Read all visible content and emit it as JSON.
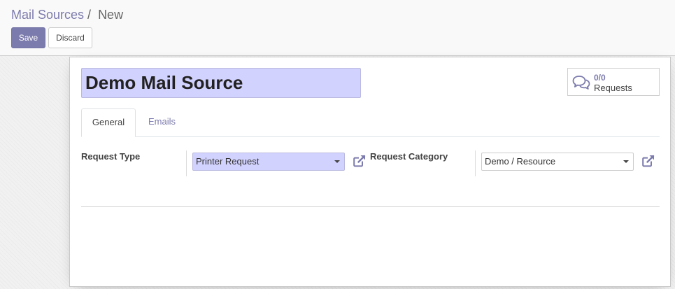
{
  "breadcrumb": {
    "parent": "Mail Sources",
    "separator": "/",
    "current": "New"
  },
  "buttons": {
    "save": "Save",
    "discard": "Discard"
  },
  "record": {
    "name": "Demo Mail Source"
  },
  "smart_button": {
    "value": "0/0",
    "label": "Requests",
    "icon": "comments-icon"
  },
  "tabs": [
    {
      "label": "General",
      "active": true
    },
    {
      "label": "Emails",
      "active": false
    }
  ],
  "fields": {
    "request_type": {
      "label": "Request Type",
      "value": "Printer Request"
    },
    "request_category": {
      "label": "Request Category",
      "value": "Demo / Resource"
    }
  },
  "colors": {
    "brand": "#7c7bad",
    "required_field_bg": "#d2d2ff"
  }
}
